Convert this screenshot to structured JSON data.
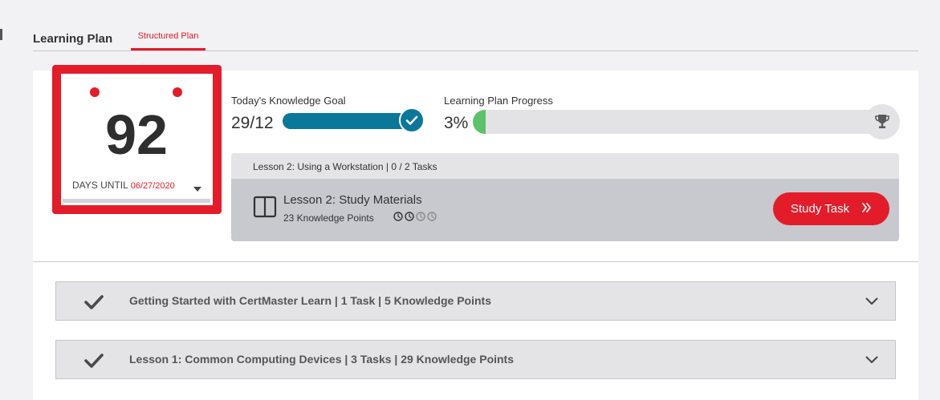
{
  "header": {
    "title": "Learning Plan",
    "active_tab": "Structured Plan"
  },
  "countdown": {
    "days": "92",
    "label": "DAYS UNTIL",
    "date": "06/27/2020"
  },
  "todays_goal": {
    "title": "Today's Knowledge Goal",
    "value": "29/12",
    "progress_fraction": 1.0,
    "complete": true
  },
  "plan_progress": {
    "title": "Learning Plan Progress",
    "value": "3%",
    "progress_fraction": 0.03
  },
  "current_lesson": {
    "header": "Lesson 2: Using a Workstation | 0 / 2 Tasks",
    "name": "Lesson 2: Study Materials",
    "points": "23 Knowledge Points",
    "difficulty_filled": 2,
    "difficulty_total": 4,
    "button_label": "Study Task"
  },
  "lessons": [
    {
      "label": "Getting Started with CertMaster Learn | 1 Task | 5 Knowledge Points",
      "complete": true
    },
    {
      "label": "Lesson 1: Common Computing Devices | 3 Tasks | 29 Knowledge Points",
      "complete": true
    }
  ],
  "colors": {
    "accent": "#e31c2a",
    "goal_bar": "#0b7799",
    "progress_fill": "#5cc36a"
  },
  "icons": {
    "goal_complete": "check-circle-icon",
    "trophy": "trophy-icon",
    "book": "book-icon",
    "difficulty": "clock-icon",
    "button": "double-chevron-right-icon",
    "row_status": "checkmark-icon",
    "row_expand": "chevron-down-icon"
  }
}
